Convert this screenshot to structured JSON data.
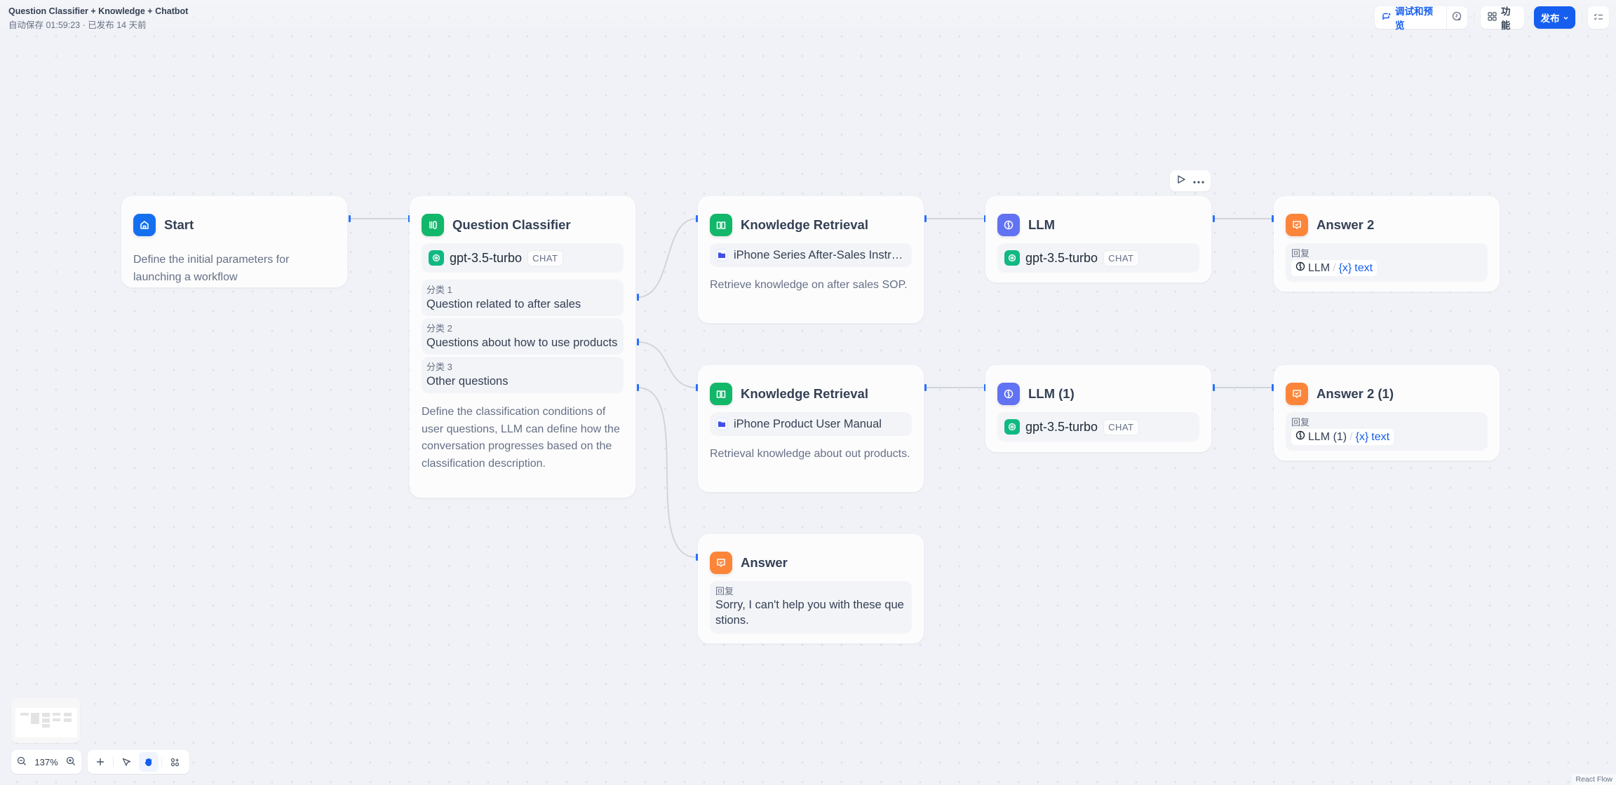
{
  "header": {
    "title": "Question Classifier + Knowledge + Chatbot",
    "status": "自动保存 01:59:23 · 已发布 14 天前",
    "debug_label": "调试和预览",
    "feature_label": "功能",
    "publish_label": "发布"
  },
  "nodes": {
    "start": {
      "title": "Start",
      "icon": "home-icon",
      "color": "#1570ef",
      "description": "Define the initial parameters for launching a workflow"
    },
    "classifier": {
      "title": "Question Classifier",
      "icon": "classifier-icon",
      "color": "#12b76a",
      "model": "gpt-3.5-turbo",
      "model_tag": "CHAT",
      "classes": [
        {
          "label": "分类 1",
          "text": "Question related to after sales"
        },
        {
          "label": "分类 2",
          "text": "Questions about how to use products"
        },
        {
          "label": "分类 3",
          "text": "Other questions"
        }
      ],
      "description": "Define the classification conditions of user questions, LLM can define how the conversation progresses based on the classification description."
    },
    "kr1": {
      "title": "Knowledge Retrieval",
      "icon": "book-icon",
      "color": "#12b76a",
      "dataset": "iPhone Series After-Sales Instructions",
      "description": "Retrieve knowledge on after sales SOP."
    },
    "kr2": {
      "title": "Knowledge Retrieval",
      "icon": "book-icon",
      "color": "#12b76a",
      "dataset": "iPhone Product User Manual",
      "description": "Retrieval knowledge about out products."
    },
    "answer": {
      "title": "Answer",
      "icon": "answer-icon",
      "color": "#fd853a",
      "reply_label": "回复",
      "reply_text": "Sorry, I can't help you with these questions."
    },
    "llm": {
      "title": "LLM",
      "icon": "brain-icon",
      "color": "#6172f3",
      "model": "gpt-3.5-turbo",
      "model_tag": "CHAT"
    },
    "llm1": {
      "title": "LLM (1)",
      "icon": "brain-icon",
      "color": "#6172f3",
      "model": "gpt-3.5-turbo",
      "model_tag": "CHAT"
    },
    "answer2": {
      "title": "Answer 2",
      "icon": "answer-icon",
      "color": "#fd853a",
      "reply_label": "回复",
      "var_source": "LLM",
      "var_name": "text"
    },
    "answer21": {
      "title": "Answer 2 (1)",
      "icon": "answer-icon",
      "color": "#fd853a",
      "reply_label": "回复",
      "var_source": "LLM (1)",
      "var_name": "text"
    }
  },
  "controls": {
    "zoom_level": "137%",
    "active_tool": "hand"
  },
  "attribution": "React Flow"
}
